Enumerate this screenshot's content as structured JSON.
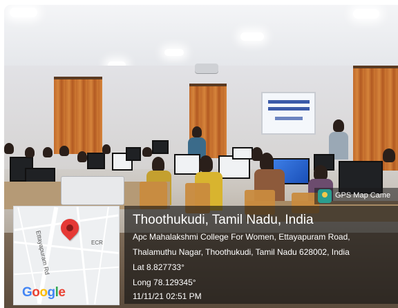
{
  "badge": {
    "text": "GPS Map Came",
    "icon": "gps-map-camera-icon"
  },
  "location": {
    "city": "Thoothukudi, Tamil Nadu, India",
    "address_line1": "Apc Mahalakshmi College For Women, Ettayapuram Road,",
    "address_line2": "Thalamuthu Nagar, Thoothukudi, Tamil Nadu 628002, India",
    "latitude": "Lat 8.827733°",
    "longitude": "Long 78.129345°",
    "datetime": "11/11/21 02:51 PM"
  },
  "map": {
    "road_label": "Ettayapuram Rd",
    "ecr_label": "ECR",
    "logo_letters": [
      "G",
      "o",
      "o",
      "g",
      "l",
      "e"
    ],
    "logo_colors": [
      "#4285F4",
      "#EA4335",
      "#FBBC05",
      "#4285F4",
      "#34A853",
      "#EA4335"
    ],
    "pin_color": "#e53935"
  },
  "screen_slide": {
    "colors": [
      "#3b5aa8",
      "#6c84c0"
    ]
  }
}
